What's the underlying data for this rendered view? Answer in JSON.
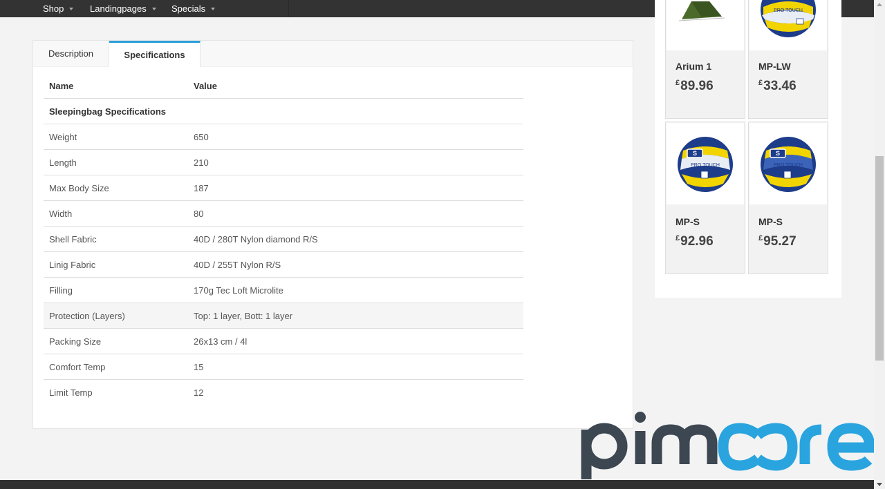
{
  "nav": {
    "items": [
      {
        "label": "Shop"
      },
      {
        "label": "Landingpages"
      },
      {
        "label": "Specials"
      }
    ]
  },
  "tabs": {
    "description": "Description",
    "specifications": "Specifications"
  },
  "specs": {
    "header_name": "Name",
    "header_value": "Value",
    "section": "Sleepingbag Specifications",
    "rows": [
      {
        "name": "Weight",
        "value": "650"
      },
      {
        "name": "Length",
        "value": "210"
      },
      {
        "name": "Max Body Size",
        "value": "187"
      },
      {
        "name": "Width",
        "value": "80"
      },
      {
        "name": "Shell Fabric",
        "value": "40D / 280T Nylon diamond R/S"
      },
      {
        "name": "Linig Fabric",
        "value": "40D / 255T Nylon R/S"
      },
      {
        "name": "Filling",
        "value": "170g Tec Loft Microlite"
      },
      {
        "name": "Protection (Layers)",
        "value": "Top: 1 layer, Bott: 1 layer"
      },
      {
        "name": "Packing Size",
        "value": "26x13 cm / 4l"
      },
      {
        "name": "Comfort Temp",
        "value": "15"
      },
      {
        "name": "Limit Temp",
        "value": "12"
      }
    ]
  },
  "products": [
    {
      "name": "Arium 1",
      "currency": "£",
      "price": "89.96",
      "image": "tent-image"
    },
    {
      "name": "MP-LW",
      "currency": "£",
      "price": "33.46",
      "image": "volleyball-image"
    },
    {
      "name": "MP-S",
      "currency": "£",
      "price": "92.96",
      "image": "volleyball-image"
    },
    {
      "name": "MP-S",
      "currency": "£",
      "price": "95.27",
      "image": "volleyball-image"
    }
  ],
  "ball_label": "PRO TOUCH",
  "logo": {
    "text": "pimcore",
    "colors": {
      "dark": "#3d4752",
      "accent": "#2aa4de"
    }
  },
  "colors": {
    "tab_accent": "#2a9fd8",
    "nav_bg": "#333333"
  }
}
